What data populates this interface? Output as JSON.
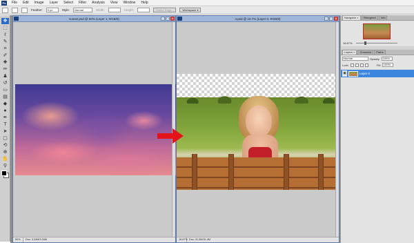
{
  "menubar": {
    "logo": "Ps",
    "items": [
      "File",
      "Edit",
      "Image",
      "Layer",
      "Select",
      "Filter",
      "Analysis",
      "View",
      "Window",
      "Help"
    ]
  },
  "options": {
    "feather_label": "Feather:",
    "feather_value": "0 px",
    "style_label": "Style:",
    "style_value": "Normal",
    "width_label": "Width:",
    "height_label": "Height:",
    "refine_edge": "Refine Edge...",
    "workspace": "Workspace ▾"
  },
  "toolbox": {
    "tools": [
      {
        "name": "move-tool",
        "glyph": "✥",
        "active": true
      },
      {
        "name": "marquee-tool",
        "glyph": "⬚"
      },
      {
        "name": "lasso-tool",
        "glyph": "ℓ"
      },
      {
        "name": "quick-select-tool",
        "glyph": "✎"
      },
      {
        "name": "crop-tool",
        "glyph": "⌗"
      },
      {
        "name": "eyedropper-tool",
        "glyph": "✐"
      },
      {
        "name": "healing-tool",
        "glyph": "✚"
      },
      {
        "name": "brush-tool",
        "glyph": "✏"
      },
      {
        "name": "clone-stamp-tool",
        "glyph": "♟"
      },
      {
        "name": "history-brush-tool",
        "glyph": "↺"
      },
      {
        "name": "eraser-tool",
        "glyph": "▭"
      },
      {
        "name": "gradient-tool",
        "glyph": "▤"
      },
      {
        "name": "blur-tool",
        "glyph": "◆"
      },
      {
        "name": "dodge-tool",
        "glyph": "●"
      },
      {
        "name": "pen-tool",
        "glyph": "✒"
      },
      {
        "name": "type-tool",
        "glyph": "T"
      },
      {
        "name": "path-select-tool",
        "glyph": "➤"
      },
      {
        "name": "shape-tool",
        "glyph": "▢"
      },
      {
        "name": "3d-rotate-tool",
        "glyph": "⟲"
      },
      {
        "name": "3d-orbit-tool",
        "glyph": "⊕"
      },
      {
        "name": "hand-tool",
        "glyph": "✋"
      },
      {
        "name": "zoom-tool",
        "glyph": "⚲"
      }
    ],
    "foreground_color": "#000000",
    "background_color": "#ffffff"
  },
  "doc1": {
    "title": "sunset.psd @ 50% (Layer 1, RGB/8)",
    "zoom": "50%",
    "doc_info": "Doc: 3.34M/3.34M"
  },
  "doc2": {
    "title": "4.psd @ 16.7% (Layer 0, RGB/8)",
    "zoom": "16.67%",
    "doc_info": "Doc: 31.3M/31.4M"
  },
  "navigator": {
    "tabs": [
      "Navigator ×",
      "Histogram",
      "Info"
    ],
    "zoom": "16.67%"
  },
  "layers": {
    "tabs": [
      "Layers ×",
      "Channels",
      "Paths"
    ],
    "blend_mode": "Normal",
    "opacity_label": "Opacity:",
    "opacity_value": "100%",
    "lock_label": "Lock:",
    "fill_label": "Fill:",
    "fill_value": "100%",
    "layer_name": "Layer 0"
  },
  "colors": {
    "accent": "#3d86e0",
    "arrow": "#e3141b",
    "title_bar": "#9fb6d9"
  }
}
